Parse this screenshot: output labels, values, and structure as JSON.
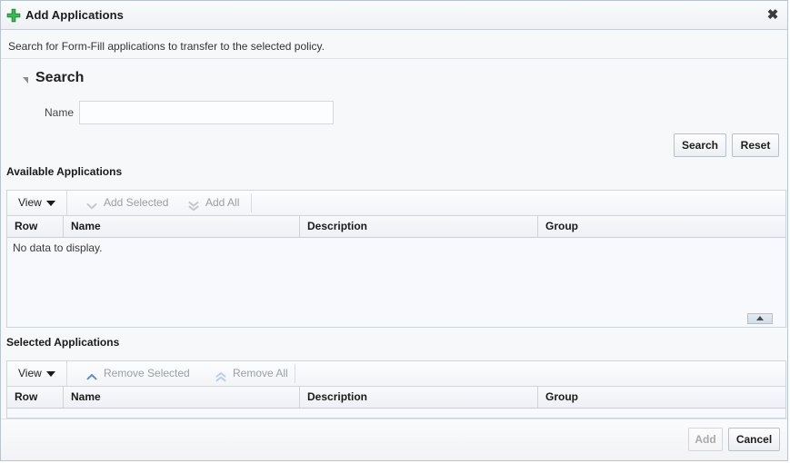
{
  "window": {
    "title": "Add Applications",
    "title_icon": "add-plus-icon",
    "close_icon": "close-icon",
    "close_glyph": "✖"
  },
  "instruction": "Search for Form-Fill applications to transfer to the selected policy.",
  "search_section": {
    "heading": "Search",
    "disclosure_icon": "disclosure-triangle-expanded-icon",
    "fields": [
      {
        "label": "Name",
        "value": "",
        "placeholder": ""
      }
    ],
    "buttons": {
      "search_label": "Search",
      "reset_label": "Reset"
    }
  },
  "available_applications": {
    "title": "Available Applications",
    "toolbar": {
      "view_label": "View",
      "view_caret_icon": "caret-down-icon",
      "actions": [
        {
          "label": "Add Selected",
          "icon": "chevron-down-icon",
          "disabled": true
        },
        {
          "label": "Add All",
          "icon": "double-chevron-down-icon",
          "disabled": true
        }
      ]
    },
    "columns": [
      "Row",
      "Name",
      "Description",
      "Group"
    ],
    "rows": [],
    "empty_message": "No data to display.",
    "resize_grip_icon": "resize-grip-icon"
  },
  "selected_applications": {
    "title": "Selected Applications",
    "toolbar": {
      "view_label": "View",
      "view_caret_icon": "caret-down-icon",
      "actions": [
        {
          "label": "Remove Selected",
          "icon": "chevron-up-icon",
          "disabled": true
        },
        {
          "label": "Remove All",
          "icon": "double-chevron-up-icon",
          "disabled": true
        }
      ]
    },
    "columns": [
      "Row",
      "Name",
      "Description",
      "Group"
    ],
    "rows": [],
    "empty_message": ""
  },
  "footer": {
    "add_label": "Add",
    "add_disabled": true,
    "cancel_label": "Cancel",
    "cancel_disabled": false
  },
  "colors": {
    "accent_green": "#39b54a",
    "chevron_blue": "#5b8fc9",
    "chevron_blue_light": "#b9cfe6",
    "disabled_gray": "#c3c8cd",
    "text": "#333333"
  }
}
